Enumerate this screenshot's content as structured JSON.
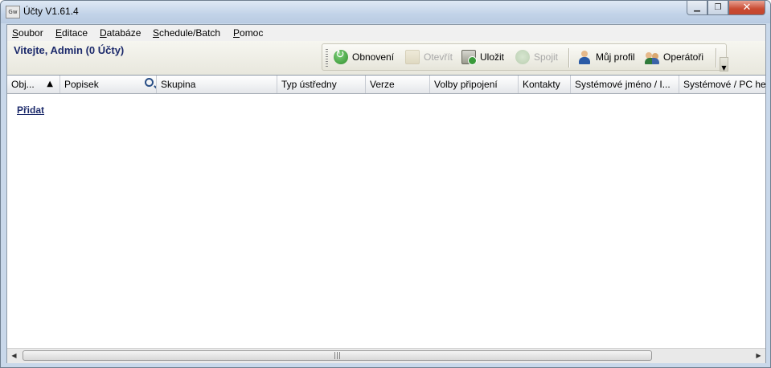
{
  "window": {
    "title": "Účty V1.61.4",
    "icon_text": "Gw"
  },
  "menu": [
    {
      "mnemonic": "S",
      "rest": "oubor"
    },
    {
      "mnemonic": "E",
      "rest": "ditace"
    },
    {
      "mnemonic": "D",
      "rest": "atabáze"
    },
    {
      "mnemonic": "S",
      "rest": "chedule/Batch"
    },
    {
      "mnemonic": "P",
      "rest": "omoc"
    }
  ],
  "header": {
    "welcome": "Vitejte, Admin  (0 Účty)"
  },
  "toolbar": {
    "refresh": "Obnovení",
    "open": "Otevřít",
    "save": "Uložit",
    "connect": "Spojit",
    "profile": "Můj profil",
    "operators": "Operátoři"
  },
  "columns": [
    "Obj...",
    "Popisek",
    "Skupina",
    "Typ ústředny",
    "Verze",
    "Volby připojení",
    "Kontakty",
    "Systémové jméno / I...",
    "Systémové / PC he"
  ],
  "grid": {
    "add_link": "Přidat",
    "sort_indicator": "▲"
  }
}
